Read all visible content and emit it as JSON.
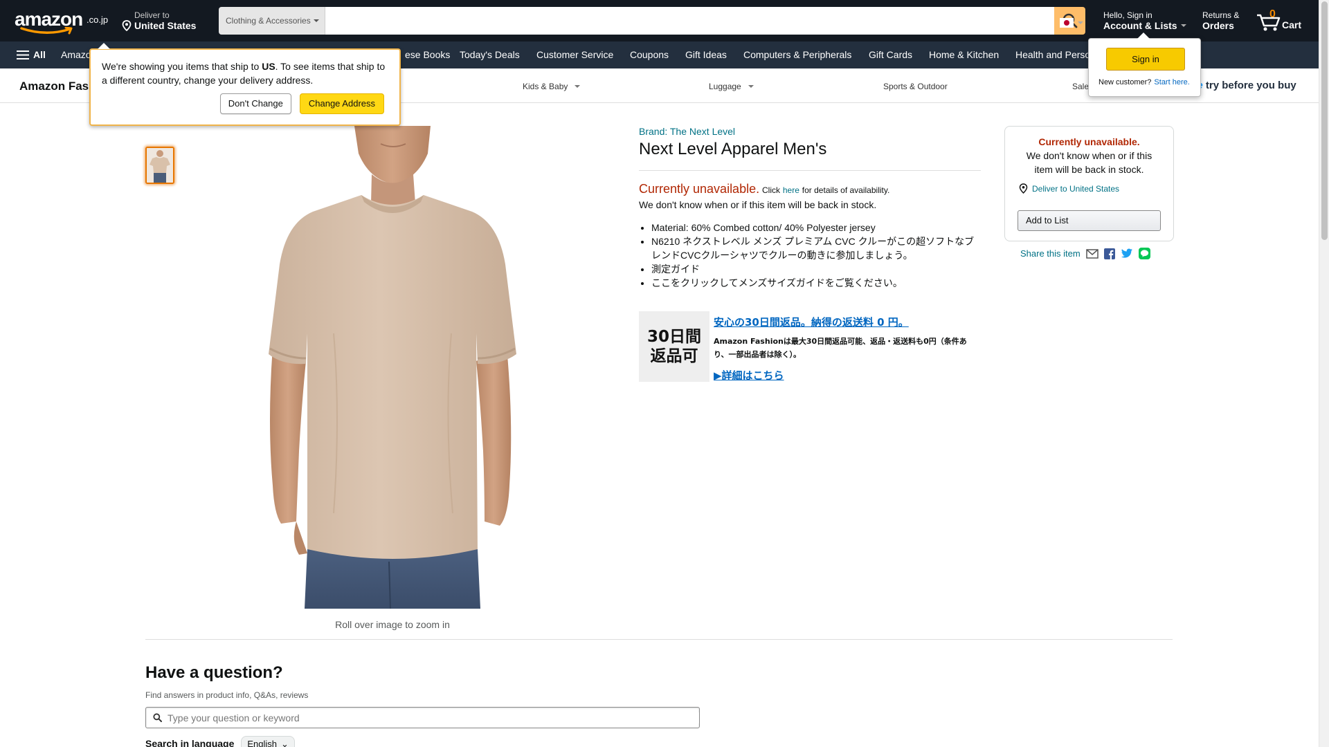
{
  "header": {
    "logo_text": "amazon",
    "logo_tld": ".co.jp",
    "deliver_line1": "Deliver to",
    "deliver_line2": "United States",
    "search_category": "Clothing & Accessories",
    "search_placeholder": "",
    "account_line1": "Hello, Sign in",
    "account_line2": "Account & Lists",
    "returns_line1": "Returns &",
    "returns_line2": "Orders",
    "cart_count": "0",
    "cart_label": "Cart"
  },
  "subnav": {
    "all_label": "All",
    "items": [
      "Amazon",
      "ese Books",
      "Today's Deals",
      "Customer Service",
      "Coupons",
      "Gift Ideas",
      "Computers & Peripherals",
      "Gift Cards",
      "Home & Kitchen",
      "Health and Personal Care"
    ]
  },
  "fashion_bar": {
    "brand": "Amazon Fashion",
    "categories": [
      "Kids & Baby",
      "Luggage",
      "Sports & Outdoor",
      "Sale"
    ],
    "promo_prefix": "me",
    "promo_text": "try before you buy"
  },
  "ship_popover": {
    "text_before": "We're showing you items that ship to ",
    "country": "US",
    "text_after": ". To see items that ship to a different country, change your delivery address.",
    "dont_change_label": "Don't Change",
    "change_address_label": "Change Address"
  },
  "signin_popover": {
    "button_label": "Sign in",
    "new_customer": "New customer?",
    "start_here": "Start here."
  },
  "product": {
    "brand_link": "Brand: The Next Level",
    "title": "Next Level Apparel Men's",
    "unavailable": "Currently unavailable.",
    "click": "Click",
    "here": "here",
    "for_details": "for details of availability.",
    "back_in_stock": "We don't know when or if this item will be back in stock.",
    "bullets": [
      "Material: 60% Combed cotton/ 40% Polyester jersey",
      "N6210 ネクストレベル メンズ プレミアム CVC クルーがこの超ソフトなブレンドCVCクルーシャツでクルーの動きに参加しましょう。",
      "測定ガイド",
      "ここをクリックしてメンズサイズガイドをご覧ください。"
    ],
    "zoom_hint": "Roll over image to zoom in"
  },
  "promo": {
    "badge_line1": "30日間",
    "badge_line2": "返品可",
    "headline": "安心の30日間返品。納得の返送料 0 円。",
    "body": "Amazon Fashionは最大30日間返品可能、返品・返送料も0円（条件あり、一部出品者は除く）。",
    "details_link": "▶詳細はこちら"
  },
  "buybox": {
    "heading": "Currently unavailable.",
    "message": "We don't know when or if this item will be back in stock.",
    "deliver_link": "Deliver to United States",
    "add_to_list": "Add to List",
    "share_label": "Share this item"
  },
  "questions": {
    "title": "Have a question?",
    "subtitle": "Find answers in product info, Q&As, reviews",
    "input_placeholder": "Type your question or keyword",
    "language_label": "Search in language",
    "language_value": "English"
  },
  "colors": {
    "nav_bg": "#131921",
    "subnav_bg": "#232f3e",
    "search_button": "#febd69",
    "unavailable_red": "#b12704",
    "link_teal": "#007185",
    "cart_count": "#f08804"
  }
}
